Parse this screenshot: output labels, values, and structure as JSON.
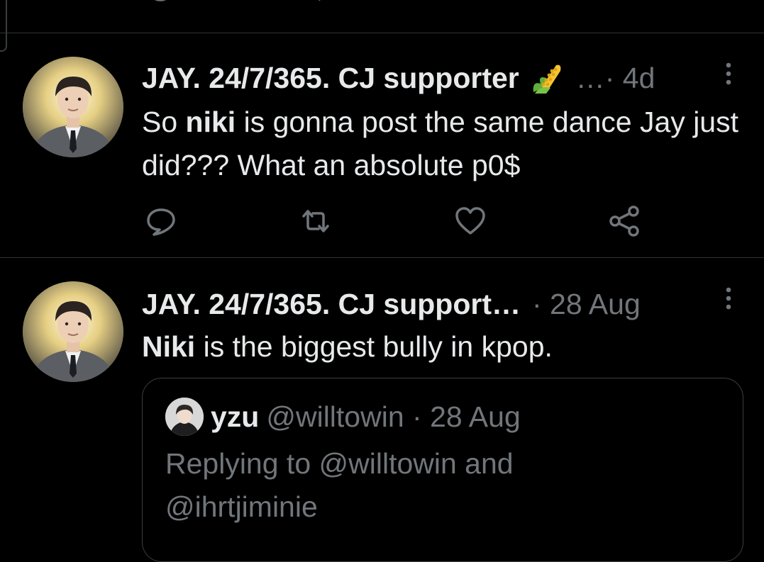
{
  "tweets": [
    {
      "display_name": "JAY. 24/7/365. CJ supporter",
      "meta": "…· 4d",
      "text_parts": [
        "So ",
        "niki",
        " is gonna post the same dance Jay just did??? What an absolute p0$"
      ]
    },
    {
      "display_name": "JAY. 24/7/365. CJ support…",
      "meta": "· 28 Aug",
      "text_parts": [
        "Niki",
        " is the biggest bully in kpop."
      ],
      "quote": {
        "display_name": "yzu",
        "handle_meta": "@willtowin · 28 Aug",
        "reply_line": "Replying to @willtowin and @ihrtjiminie"
      }
    }
  ],
  "icons": {
    "reply": "reply-icon",
    "retweet": "retweet-icon",
    "like": "heart-icon",
    "share": "share-icon",
    "more": "more-vertical-icon",
    "emoji": "corn-emoji-icon"
  },
  "colors": {
    "background": "#000000",
    "text_primary": "#e7e9ea",
    "text_secondary": "#71767b",
    "divider": "#2f3336"
  }
}
